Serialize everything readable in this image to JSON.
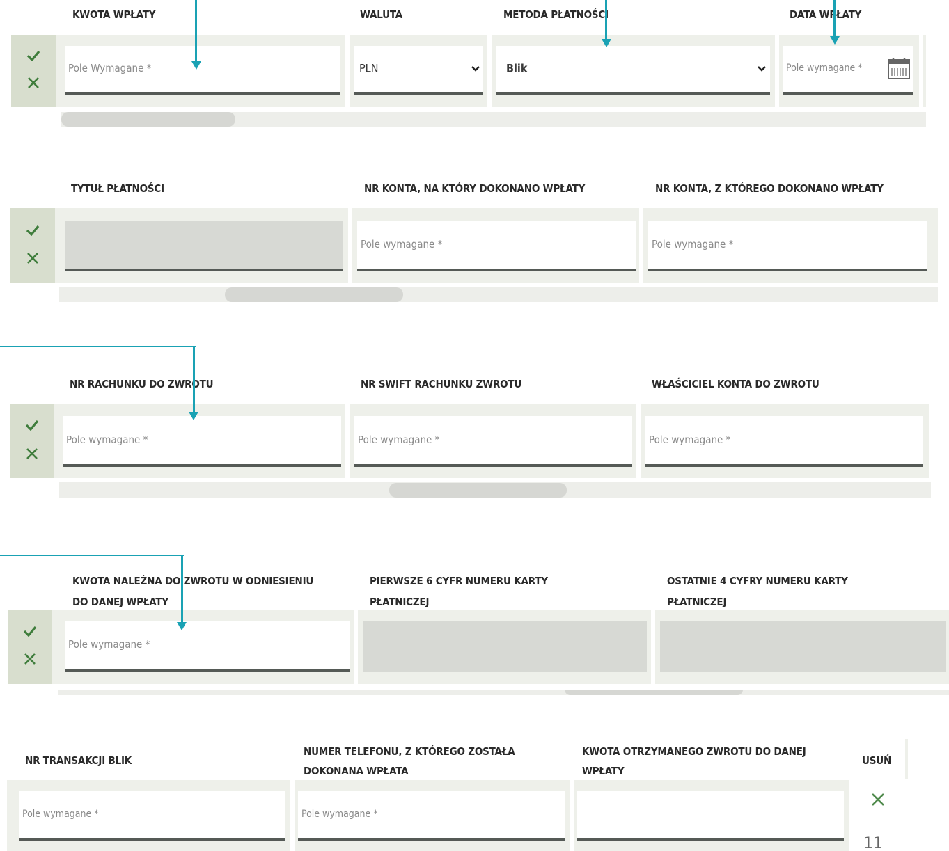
{
  "section1": {
    "labels": {
      "amount": "KWOTA WPŁATY",
      "currency": "WALUTA",
      "method": "METODA PŁATNOŚCI",
      "date": "DATA WPŁATY"
    },
    "amount_placeholder": "Pole Wymagane *",
    "currency_value": "PLN",
    "method_value": "Blik",
    "date_placeholder": "Pole wymagane *"
  },
  "section2": {
    "labels": {
      "title": "TYTUŁ PŁATNOŚCI",
      "to_account": "NR KONTA, NA KTÓRY DOKONANO WPŁATY",
      "from_account": "NR KONTA, Z KTÓREGO DOKONANO WPŁATY"
    },
    "to_account_placeholder": "Pole wymagane *",
    "from_account_placeholder": "Pole wymagane *"
  },
  "section3": {
    "labels": {
      "refund_account": "NR RACHUNKU DO ZWROTU",
      "swift": "NR SWIFT RACHUNKU ZWROTU",
      "owner": "WŁAŚCICIEL KONTA DO ZWROTU"
    },
    "refund_account_placeholder": "Pole wymagane *",
    "swift_placeholder": "Pole wymagane *",
    "owner_placeholder": "Pole wymagane *"
  },
  "section4": {
    "labels": {
      "refund_amount": "KWOTA NALEŻNA DO ZWROTU W ODNIESIENIU\nDO DANEJ WPŁATY",
      "first6": "PIERWSZE 6 CYFR NUMERU KARTY\nPŁATNICZEJ",
      "last4": "OSTATNIE 4 CYFRY NUMERU KARTY\nPŁATNICZEJ"
    },
    "refund_amount_placeholder": "Pole wymagane *"
  },
  "section5": {
    "labels": {
      "blik": "NR TRANSAKCJI BLIK",
      "phone": "NUMER TELEFONU, Z KTÓREGO ZOSTAŁA\nDOKONANA WPŁATA",
      "received": "KWOTA OTRZYMANEGO ZWROTU DO DANEJ\nWPŁATY",
      "delete": "USUŃ"
    },
    "blik_placeholder": "Pole wymagane *",
    "phone_placeholder": "Pole wymagane *",
    "row_number": "11"
  },
  "icons": [
    "check-icon",
    "close-icon",
    "chevron-down-icon",
    "calendar-icon",
    "arrow-icon"
  ],
  "colors": {
    "accent_arrow": "#1aa2b4",
    "check_green": "#3f7d3c",
    "band": "#eef0ea",
    "check_box": "#d8dece",
    "disabled_field": "#d7d9d4",
    "field_underline": "#555a56"
  }
}
